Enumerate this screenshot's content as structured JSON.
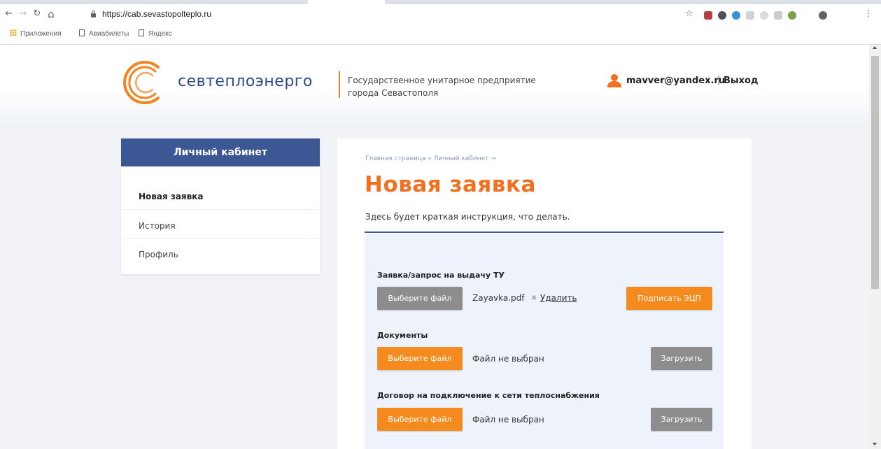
{
  "browser": {
    "url": "https://cab.sevastopolteplo.ru",
    "bookmarks": [
      "Приложения",
      "Авиабилеты",
      "Яндекс"
    ]
  },
  "header": {
    "logo_text": "севтеплоэнерго",
    "tagline": "Государственное унитарное предприятие города Севастополя",
    "user_email": "mavver@yandex.ru",
    "user_separator": "|",
    "logout": "Выход"
  },
  "sidebar": {
    "title": "Личный кабинет",
    "items": [
      {
        "label": "Новая заявка",
        "active": true
      },
      {
        "label": "История",
        "active": false
      },
      {
        "label": "Профиль",
        "active": false
      }
    ]
  },
  "main": {
    "breadcrumb": "Главная страница » Личный кабинет →",
    "title": "Новая заявка",
    "instruction": "Здесь будет краткая инструкция, что делать.",
    "fields": [
      {
        "label": "Заявка/запрос на выдачу ТУ",
        "choose_label": "Выберите файл",
        "file_name": "Zayavka.pdf",
        "remove_x": "✖",
        "remove_label": "Удалить",
        "action_label": "Подписать ЭЦП"
      },
      {
        "label": "Документы",
        "choose_label": "Выберите файл",
        "file_name": "Файл не выбран",
        "action_label": "Загрузить"
      },
      {
        "label": "Договор на подключение к сети теплоснабжения",
        "choose_label": "Выберите файл",
        "file_name": "Файл не выбран",
        "action_label": "Загрузить"
      }
    ]
  },
  "colors": {
    "brand_blue": "#3d5794",
    "brand_orange": "#f37021",
    "button_orange": "#f58a1f",
    "button_gray": "#8d8d8d"
  }
}
